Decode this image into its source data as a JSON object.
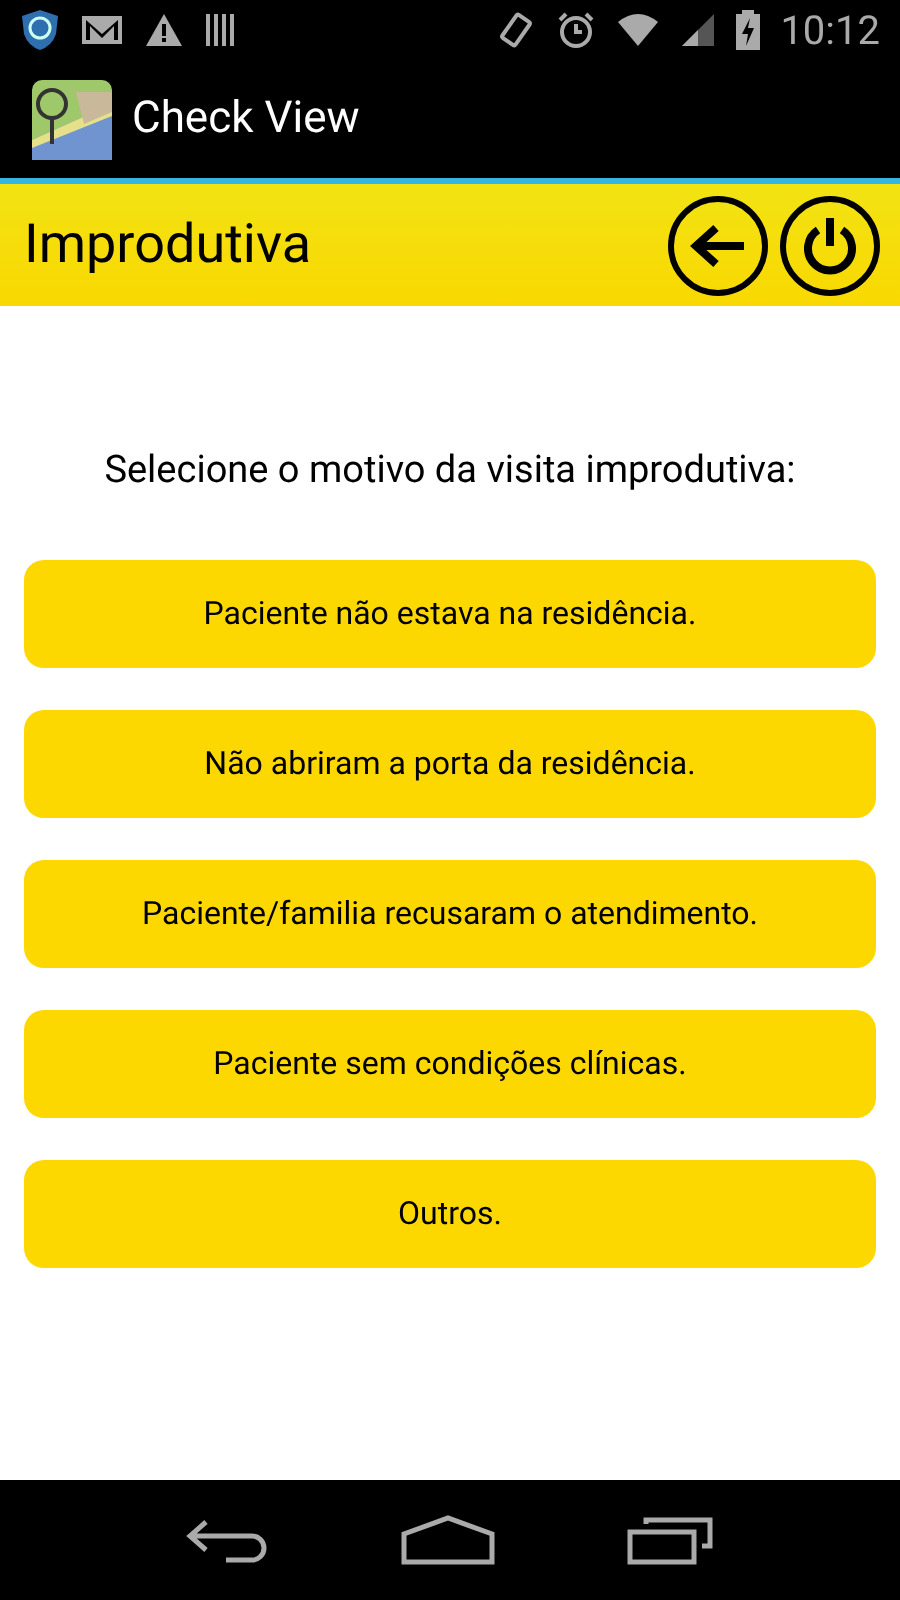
{
  "status_bar": {
    "time": "10:12"
  },
  "app_bar": {
    "title": "Check View"
  },
  "header": {
    "title": "Improdutiva"
  },
  "prompt": "Selecione o motivo da visita improdutiva:",
  "options": [
    {
      "label": "Paciente não estava na residência."
    },
    {
      "label": "Não abriram a porta da residência."
    },
    {
      "label": "Paciente/familia recusaram o atendimento."
    },
    {
      "label": "Paciente sem condições clínicas."
    },
    {
      "label": "Outros."
    }
  ]
}
